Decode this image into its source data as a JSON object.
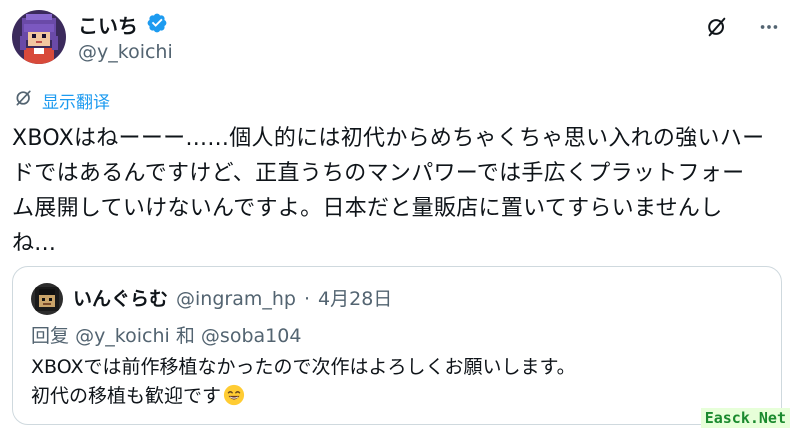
{
  "author": {
    "name": "こいち",
    "handle": "@y_koichi"
  },
  "translate_label": "显示翻译",
  "tweet_text": "XBOXはねーーー......個人的には初代からめちゃくちゃ思い入れの強いハー\nドではあるんですけど、正直うちのマンパワーでは手広くプラットフォー\nム展開していけないんですよ。日本だと量販店に置いてすらいませんし\nね...",
  "quote": {
    "name": "いんぐらむ",
    "handle": "@ingram_hp",
    "separator": "·",
    "date": "4月28日",
    "reply_prefix": "回复",
    "reply_user1": "@y_koichi",
    "reply_and": "和",
    "reply_user2": "@soba104",
    "text_line1": "XBOXでは前作移植なかったので次作はよろしくお願いします。",
    "text_line2": "初代の移植も歓迎です"
  },
  "icons": {
    "verified": "verified-badge-icon",
    "grok": "grok-icon",
    "more": "more-icon",
    "translate": "translate-icon",
    "emoji": "grinning-emoji-icon"
  },
  "colors": {
    "accent": "#1d9bf0",
    "text": "#0f1419",
    "muted": "#536471",
    "border": "#cfd9de"
  },
  "watermark": "Easck.Net"
}
